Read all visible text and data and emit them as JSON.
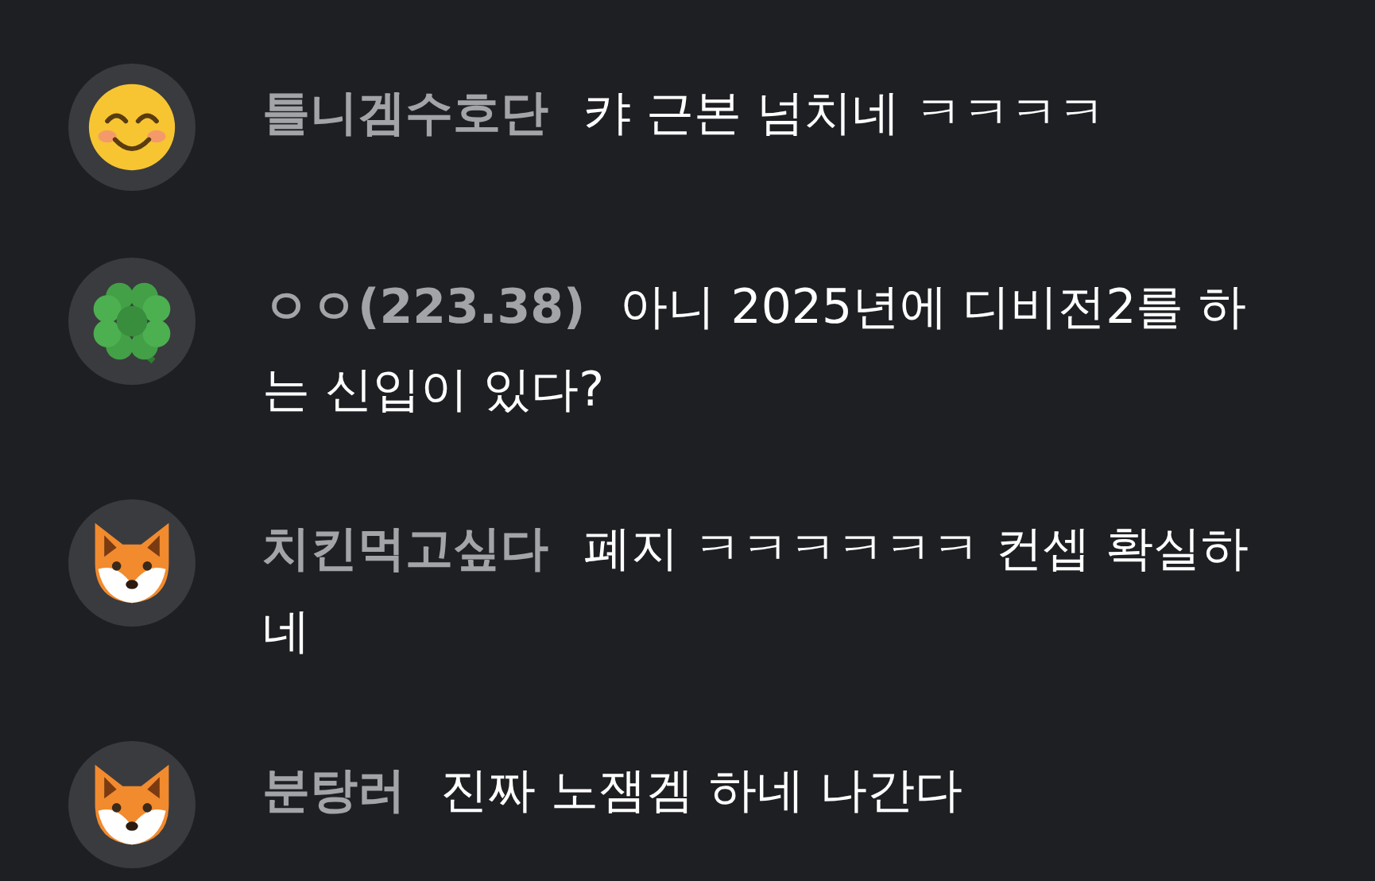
{
  "messages": [
    {
      "avatar": {
        "kind": "smiley"
      },
      "name": "틀니겜수호단",
      "text": "캬 근본 넘치네 ㅋㅋㅋㅋ"
    },
    {
      "avatar": {
        "kind": "clover"
      },
      "name": "ㅇㅇ(223.38)",
      "text": "아니 2025년에 디비전2를 하는 신입이 있다?"
    },
    {
      "avatar": {
        "kind": "fox"
      },
      "name": "치킨먹고싶다",
      "text": "폐지 ㅋㅋㅋㅋㅋㅋ 컨셉 확실하네"
    },
    {
      "avatar": {
        "kind": "fox"
      },
      "name": "분탕러",
      "text": "진짜 노잼겜 하네 나간다"
    }
  ]
}
